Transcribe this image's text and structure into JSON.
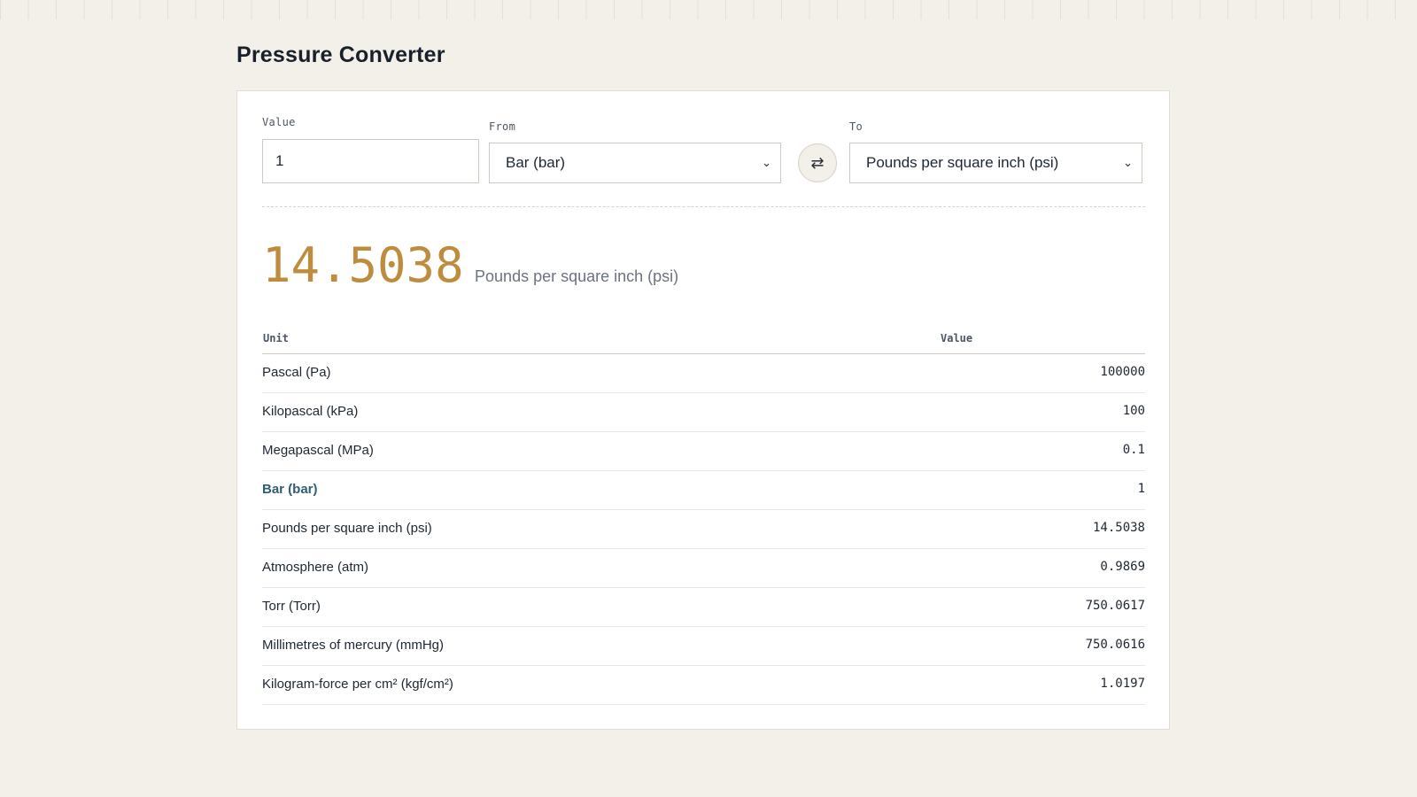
{
  "page": {
    "title": "Pressure Converter"
  },
  "form": {
    "value_label": "Value",
    "value": "1",
    "from_label": "From",
    "from_selected": "Bar (bar)",
    "to_label": "To",
    "to_selected": "Pounds per square inch (psi)",
    "swap_icon": "swap-arrows-icon",
    "swap_glyph": "⇄",
    "chevron_glyph": "⌄"
  },
  "result": {
    "value": "14.5038",
    "unit": "Pounds per square inch (psi)"
  },
  "table": {
    "headers": {
      "unit": "Unit",
      "value": "Value"
    },
    "rows": [
      {
        "unit": "Pascal (Pa)",
        "value": "100000"
      },
      {
        "unit": "Kilopascal (kPa)",
        "value": "100"
      },
      {
        "unit": "Megapascal (MPa)",
        "value": "0.1"
      },
      {
        "unit": "Bar (bar)",
        "value": "1",
        "active": true
      },
      {
        "unit": "Pounds per square inch (psi)",
        "value": "14.5038"
      },
      {
        "unit": "Atmosphere (atm)",
        "value": "0.9869"
      },
      {
        "unit": "Torr (Torr)",
        "value": "750.0617"
      },
      {
        "unit": "Millimetres of mercury (mmHg)",
        "value": "750.0616"
      },
      {
        "unit": "Kilogram-force per cm² (kgf/cm²)",
        "value": "1.0197"
      }
    ]
  },
  "colors": {
    "background": "#f3f0e9",
    "accent_result": "#bf8c3e",
    "active_row": "#2f5d73"
  }
}
